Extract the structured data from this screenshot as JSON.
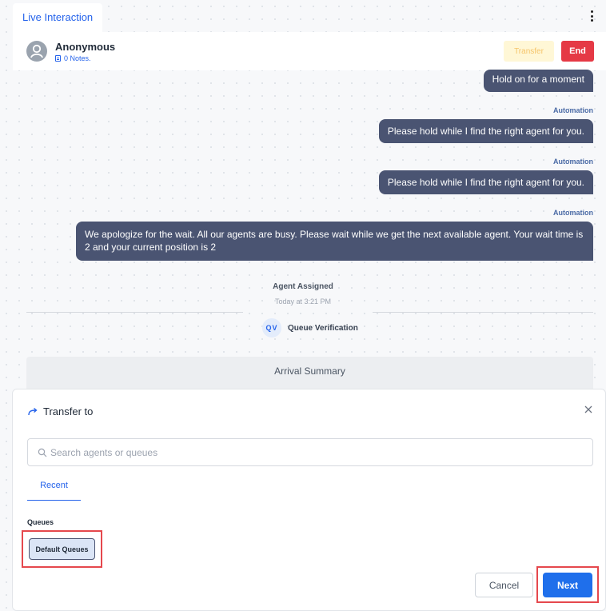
{
  "top_tab": {
    "label": "Live Interaction"
  },
  "header": {
    "contact_name": "Anonymous",
    "notes_label": "0 Notes.",
    "transfer_label": "Transfer",
    "end_label": "End"
  },
  "messages": [
    {
      "text": "Hold on for a moment",
      "sender": ""
    },
    {
      "text": "Please hold while I find the right agent for you.",
      "sender": "Automation"
    },
    {
      "text": "Please hold while I find the right agent for you.",
      "sender": "Automation"
    },
    {
      "text": "We apologize for the wait. All our agents are busy. Please wait while we get the next available agent. Your wait time is 2 and your current position is 2",
      "sender": "Automation"
    }
  ],
  "system_event": {
    "title": "Agent Assigned",
    "time": "Today at 3:21 PM"
  },
  "queue": {
    "badge": "QV",
    "name": "Queue Verification"
  },
  "arrival_summary": {
    "label": "Arrival Summary"
  },
  "transfer_modal": {
    "title": "Transfer to",
    "search_placeholder": "Search agents or queues",
    "tabs": [
      "Recent"
    ],
    "section_label": "Queues",
    "queue_option": "Default Queues",
    "cancel_label": "Cancel",
    "next_label": "Next"
  },
  "colors": {
    "accent": "#2563eb",
    "bubble": "#4a5472",
    "end": "#e53945",
    "next": "#1f6feb",
    "highlight": "#e5484d"
  }
}
